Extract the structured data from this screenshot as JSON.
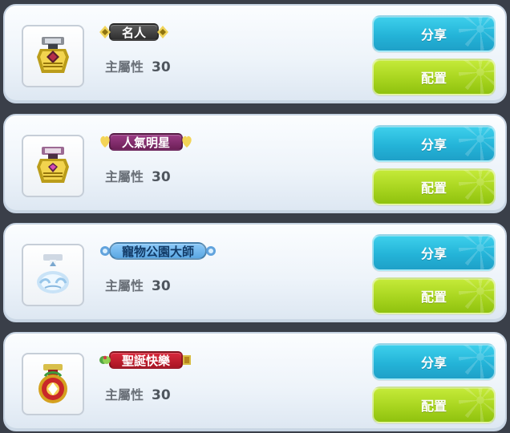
{
  "medals": [
    {
      "title": "名人",
      "stat_label": "主屬性",
      "stat_value": "30",
      "share_label": "分享",
      "assign_label": "配置",
      "icon": "celebrity-medal-icon"
    },
    {
      "title": "人氣明星",
      "stat_label": "主屬性",
      "stat_value": "30",
      "share_label": "分享",
      "assign_label": "配置",
      "icon": "popular-star-medal-icon"
    },
    {
      "title": "寵物公園大師",
      "stat_label": "主屬性",
      "stat_value": "30",
      "share_label": "分享",
      "assign_label": "配置",
      "icon": "pet-park-master-medal-icon"
    },
    {
      "title": "聖誕快樂",
      "stat_label": "主屬性",
      "stat_value": "30",
      "share_label": "分享",
      "assign_label": "配置",
      "icon": "merry-christmas-medal-icon"
    }
  ],
  "colors": {
    "background": "#3a3f49",
    "card": "#eef4fa",
    "share_button": "#24b4d8",
    "assign_button": "#a8d51f"
  }
}
